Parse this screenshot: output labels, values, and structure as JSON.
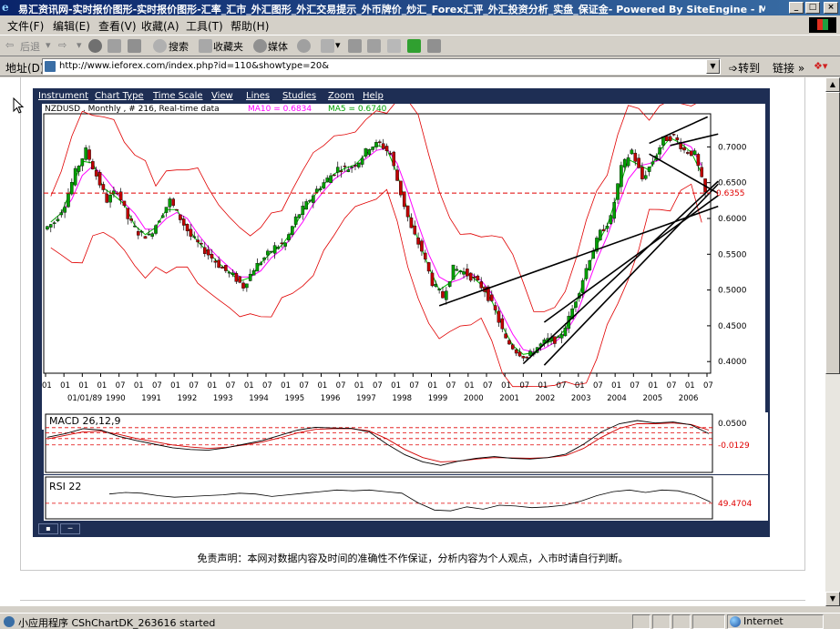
{
  "window": {
    "title": "易汇资讯网-实时报价图形-实时报价图形-汇率_汇市_外汇图形_外汇交易提示_外币牌价_炒汇_Forex汇评_外汇投资分析_实盘_保证金- Powered By SiteEngine - Micro...",
    "minimize": "_",
    "maximize": "□",
    "close": "×"
  },
  "menu": [
    "文件(F)",
    "编辑(E)",
    "查看(V)",
    "收藏(A)",
    "工具(T)",
    "帮助(H)"
  ],
  "toolbar": {
    "back": "后退",
    "search": "搜索",
    "favorites": "收藏夹",
    "media": "媒体",
    "icons": [
      "back-arrow",
      "forward-arrow",
      "stop",
      "refresh",
      "home",
      "search",
      "favorites",
      "media",
      "history",
      "mail",
      "print",
      "edit",
      "discuss",
      "messenger"
    ]
  },
  "address": {
    "label": "地址(D)",
    "url": "http://www.ieforex.com/index.php?id=110&showtype=20&",
    "go": "转到",
    "links": "链接"
  },
  "applet_menu": [
    "Instrument",
    "Chart Type",
    "Time Scale",
    "View",
    "Lines",
    "Studies",
    "Zoom",
    "Help"
  ],
  "chart_header": {
    "info": "NZDUSD , Monthly , # 216, Real-time data",
    "ma10_label": "MA10 = 0.6834",
    "ma5_label": "MA5 = 0.6740"
  },
  "chart_data": [
    {
      "type": "candlestick",
      "instrument": "NZDUSD",
      "period": "Monthly",
      "y_ticks": [
        "0.7000",
        "0.6500",
        "0.6000",
        "0.5500",
        "0.5000",
        "0.4500",
        "0.4000"
      ],
      "ylim": [
        0.385,
        0.745
      ],
      "current_price_label": "0.6355",
      "current_price": 0.6355,
      "month_ticks": [
        "01",
        "01",
        "01",
        "01",
        "07",
        "01",
        "07",
        "01",
        "07",
        "01",
        "07",
        "01",
        "07",
        "01",
        "07",
        "01",
        "07",
        "01",
        "07",
        "01",
        "07",
        "01",
        "07",
        "01",
        "07",
        "01",
        "07",
        "01",
        "07",
        "01",
        "07",
        "01",
        "07",
        "01",
        "07",
        "01",
        "07"
      ],
      "year_labels": [
        "01/01/89",
        "1990",
        "1991",
        "1992",
        "1993",
        "1994",
        "1995",
        "1996",
        "1997",
        "1998",
        "1999",
        "2000",
        "2001",
        "2002",
        "2003",
        "2004",
        "2005",
        "2006"
      ],
      "close_series": [
        0.595,
        0.62,
        0.665,
        0.695,
        0.66,
        0.625,
        0.64,
        0.6,
        0.58,
        0.575,
        0.6,
        0.625,
        0.6,
        0.575,
        0.56,
        0.545,
        0.53,
        0.52,
        0.505,
        0.53,
        0.545,
        0.56,
        0.565,
        0.6,
        0.62,
        0.64,
        0.655,
        0.67,
        0.67,
        0.68,
        0.7,
        0.705,
        0.69,
        0.635,
        0.585,
        0.555,
        0.51,
        0.49,
        0.53,
        0.525,
        0.515,
        0.5,
        0.47,
        0.43,
        0.415,
        0.405,
        0.42,
        0.43,
        0.43,
        0.46,
        0.5,
        0.545,
        0.58,
        0.6,
        0.67,
        0.695,
        0.655,
        0.68,
        0.71,
        0.715,
        0.695,
        0.69,
        0.635
      ],
      "series": [
        {
          "name": "MA10",
          "value_label": "0.6834",
          "color": "#ff00ff"
        },
        {
          "name": "MA5",
          "value_label": "0.6740",
          "color": "#00c000"
        }
      ],
      "colors": {
        "up": "#00a000",
        "down": "#c00000",
        "band": "#e00000",
        "trendline": "#000000"
      }
    },
    {
      "type": "line",
      "name": "MACD",
      "label": "MACD 26,12,9",
      "y_ticks": [
        "0.0500",
        "-0.0129"
      ],
      "ylim": [
        -0.09,
        0.07
      ],
      "levels": [
        0.037,
        0.022,
        0.006,
        -0.012
      ],
      "macd": [
        0.01,
        0.02,
        0.034,
        0.03,
        0.012,
        0.0,
        -0.01,
        -0.02,
        -0.025,
        -0.027,
        -0.02,
        -0.01,
        0.0,
        0.015,
        0.03,
        0.038,
        0.036,
        0.035,
        0.025,
        -0.01,
        -0.04,
        -0.06,
        -0.07,
        -0.058,
        -0.05,
        -0.045,
        -0.05,
        -0.052,
        -0.048,
        -0.038,
        -0.01,
        0.025,
        0.048,
        0.057,
        0.05,
        0.053,
        0.045,
        0.02
      ],
      "signal": [
        0.005,
        0.015,
        0.025,
        0.027,
        0.018,
        0.006,
        -0.003,
        -0.012,
        -0.018,
        -0.022,
        -0.019,
        -0.012,
        -0.004,
        0.008,
        0.022,
        0.032,
        0.034,
        0.034,
        0.028,
        0.005,
        -0.025,
        -0.048,
        -0.06,
        -0.058,
        -0.052,
        -0.048,
        -0.049,
        -0.05,
        -0.048,
        -0.042,
        -0.022,
        0.01,
        0.035,
        0.048,
        0.048,
        0.05,
        0.046,
        0.03
      ]
    },
    {
      "type": "line",
      "name": "RSI",
      "label": "RSI 22",
      "y_ticks": [
        "49.4704"
      ],
      "ylim": [
        30,
        80
      ],
      "level": 49.47,
      "values": [
        61,
        63,
        62,
        59,
        57,
        58,
        59,
        60,
        62,
        61,
        58,
        60,
        62,
        64,
        66,
        65,
        66,
        64,
        62,
        50,
        41,
        40,
        45,
        42,
        47,
        46,
        44,
        45,
        47,
        52,
        59,
        64,
        66,
        63,
        66,
        65,
        60,
        51
      ]
    }
  ],
  "disclaimer": "免责声明：本网对数据内容及时间的准确性不作保证，分析内容为个人观点，入市时请自行判断。",
  "status": {
    "text": "小应用程序 CShChartDK_263616 started",
    "zone": "Internet"
  }
}
